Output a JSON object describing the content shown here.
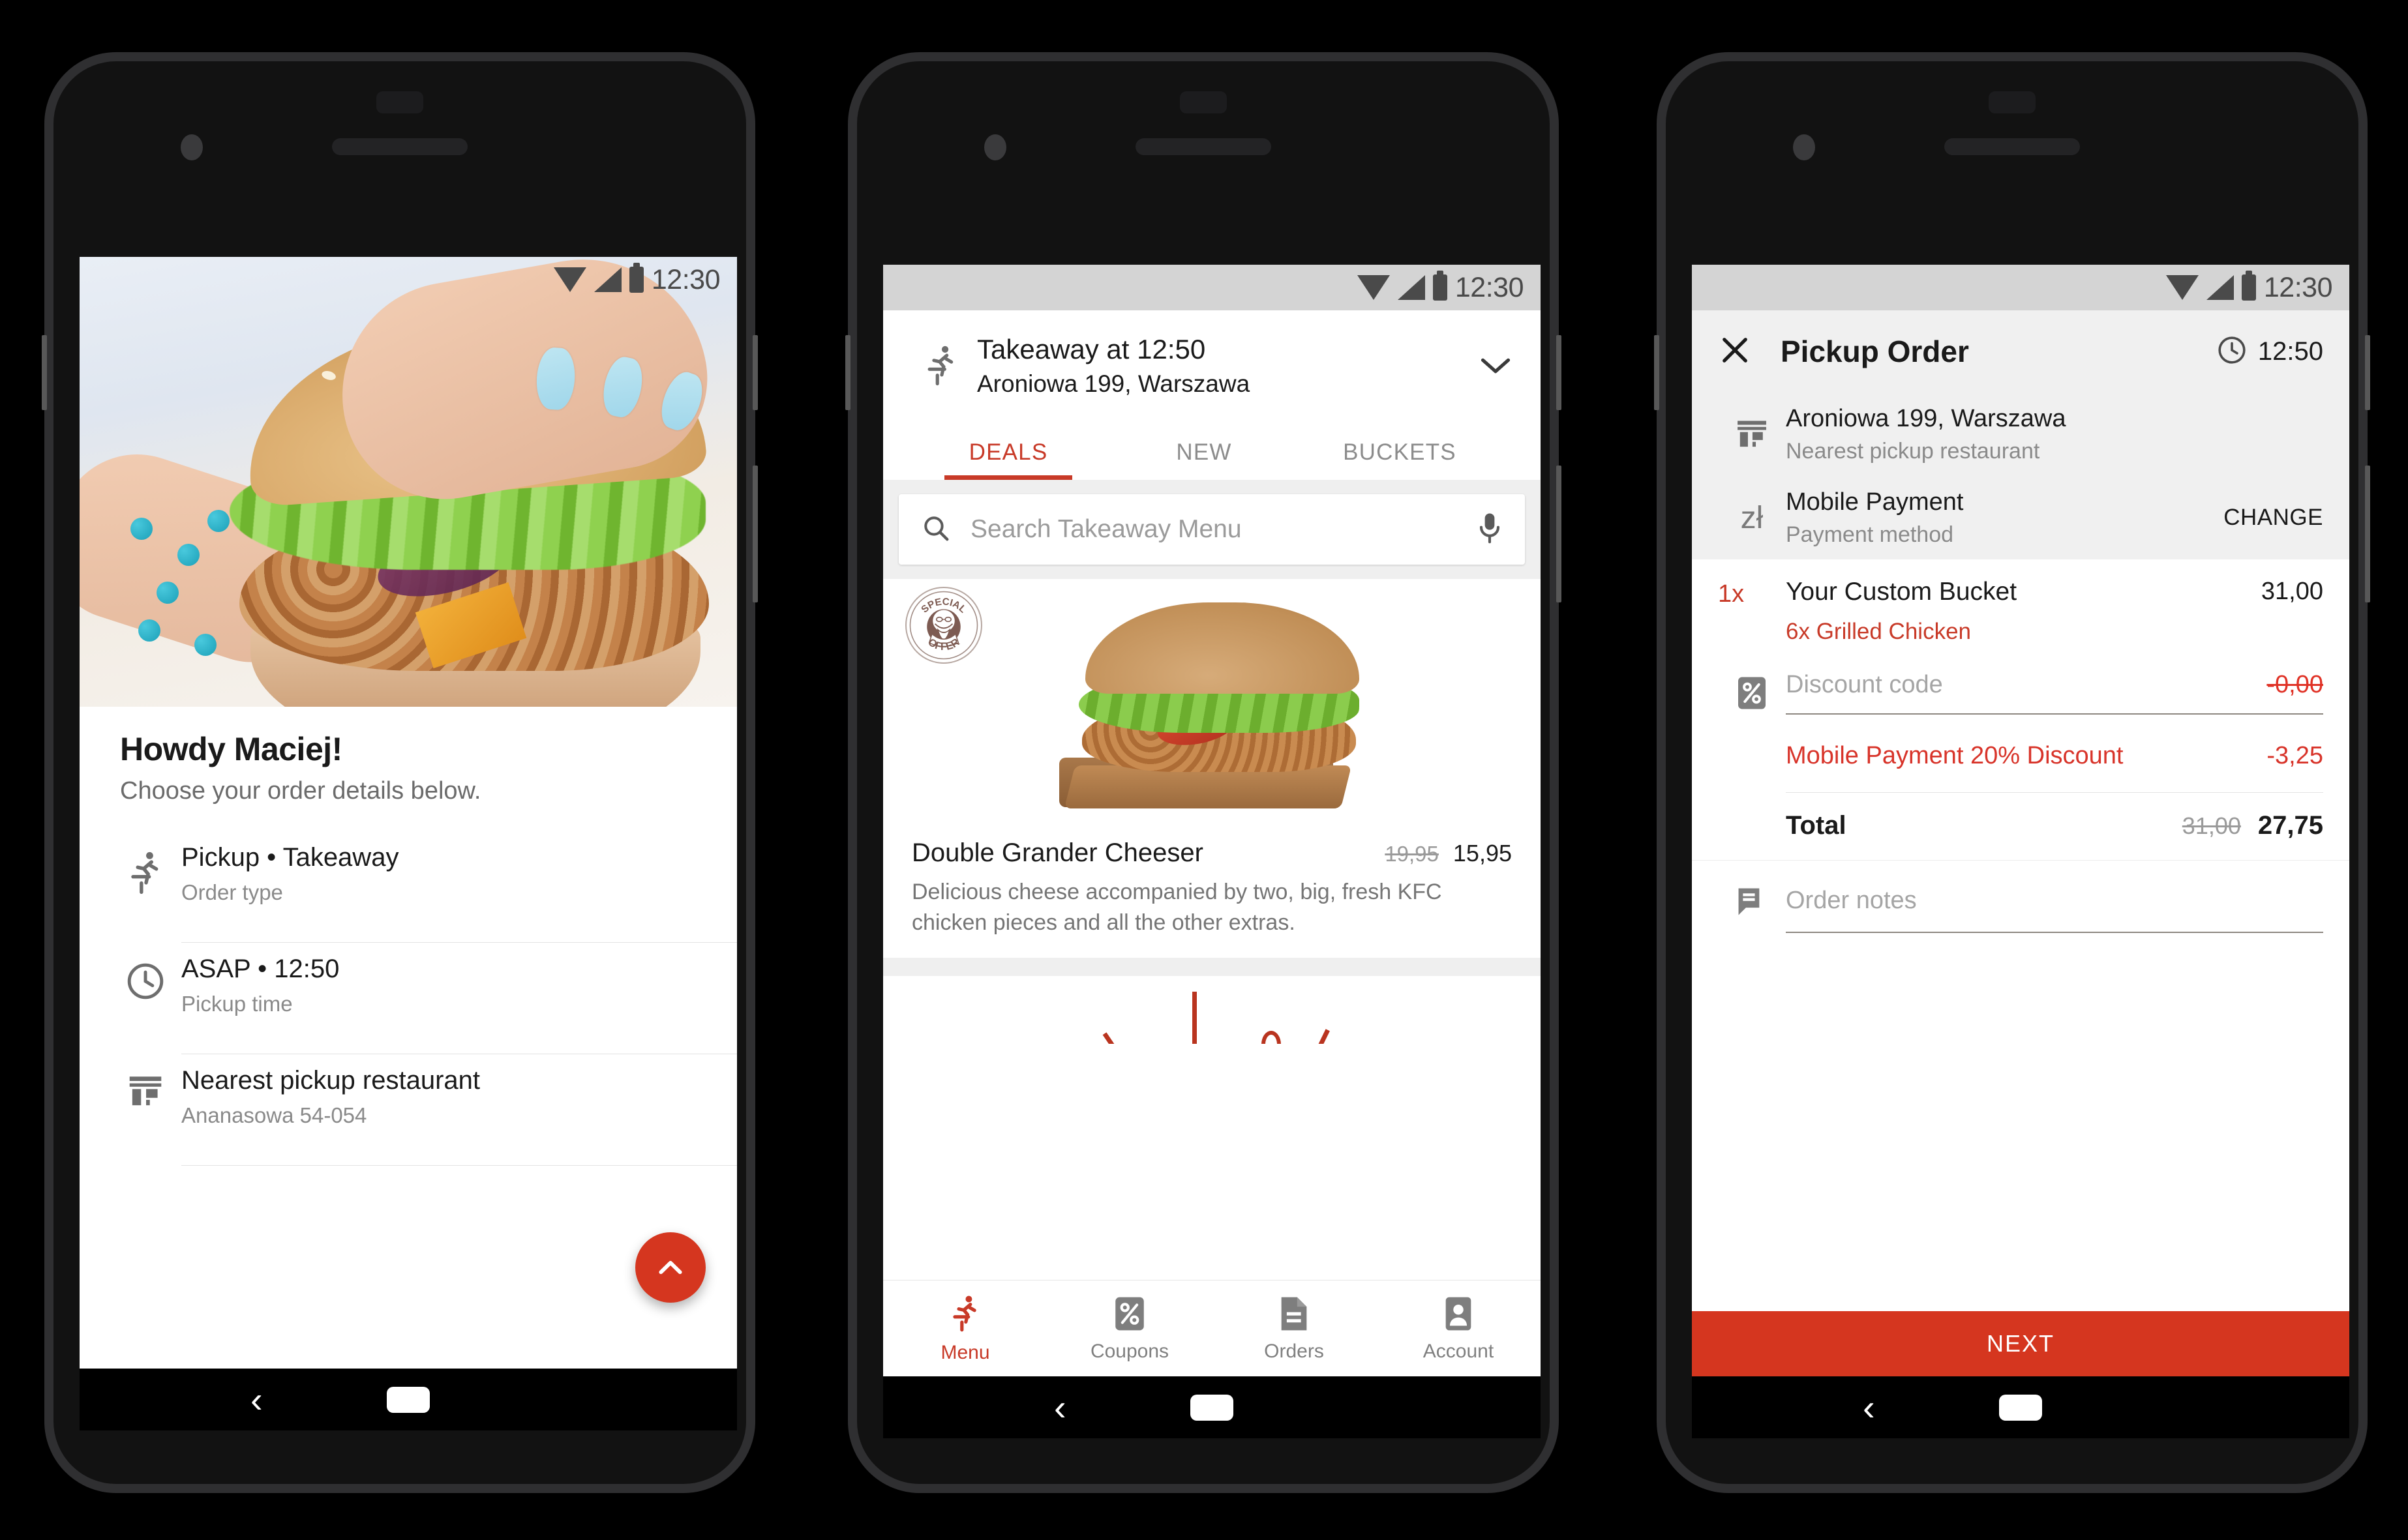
{
  "phones": {
    "phone1": {
      "status_bar": {
        "time": "12:30",
        "icons": [
          "wifi-icon",
          "signal-icon",
          "battery-icon"
        ]
      },
      "greeting": {
        "title": "Howdy Maciej!",
        "subtitle": "Choose your order details below."
      },
      "rows": [
        {
          "icon": "runner-icon",
          "main": "Pickup • Takeaway",
          "sub": "Order type"
        },
        {
          "icon": "clock-icon",
          "main": "ASAP • 12:50",
          "sub": "Pickup time"
        },
        {
          "icon": "store-icon",
          "main": "Nearest pickup restaurant",
          "sub": "Ananasowa 54-054"
        }
      ],
      "fab": {
        "icon": "chevron-up-icon"
      },
      "nav": {
        "back": "‹",
        "home": "home-pill"
      }
    },
    "phone2": {
      "status_bar": {
        "time": "12:30"
      },
      "header": {
        "icon": "runner-icon",
        "line1": "Takeaway at 12:50",
        "line2": "Aroniowa 199, Warszawa",
        "chevron": "chevron-down-icon"
      },
      "tabs": [
        {
          "label": "DEALS",
          "active": true
        },
        {
          "label": "NEW",
          "active": false
        },
        {
          "label": "BUCKETS",
          "active": false
        }
      ],
      "search": {
        "icon": "search-icon",
        "placeholder": "Search Takeaway Menu",
        "mic": "mic-icon"
      },
      "badge": {
        "line1": "SPECIAL",
        "line2": "OFFER",
        "face": "colonel-sanders-icon"
      },
      "product": {
        "name": "Double Grander Cheeser",
        "price_old": "19,95",
        "price_new": "15,95",
        "description": "Delicious cheese accompanied by two, big, fresh KFC chicken pieces and all the other extras."
      },
      "bottom_nav": [
        {
          "label": "Menu",
          "icon": "runner-icon",
          "active": true
        },
        {
          "label": "Coupons",
          "icon": "percent-icon",
          "active": false
        },
        {
          "label": "Orders",
          "icon": "document-icon",
          "active": false
        },
        {
          "label": "Account",
          "icon": "person-card-icon",
          "active": false
        }
      ],
      "nav": {
        "back": "‹"
      }
    },
    "phone3": {
      "status_bar": {
        "time": "12:30"
      },
      "appbar": {
        "close": "close-icon",
        "title": "Pickup Order",
        "clock_icon": "clock-icon",
        "time": "12:50"
      },
      "details": [
        {
          "icon": "store-icon",
          "main": "Aroniowa 199, Warszawa",
          "sub": "Nearest pickup restaurant",
          "action": ""
        },
        {
          "icon": "zloty-icon",
          "main": "Mobile Payment",
          "sub": "Payment method",
          "action": "CHANGE"
        }
      ],
      "item": {
        "qty": "1x",
        "name": "Your Custom Bucket",
        "price": "31,00",
        "option": "6x Grilled Chicken"
      },
      "discount": {
        "icon": "percent-icon",
        "placeholder": "Discount code",
        "value": "-0,00"
      },
      "promo": {
        "label": "Mobile Payment 20% Discount",
        "value": "-3,25"
      },
      "total": {
        "label": "Total",
        "old": "31,00",
        "new": "27,75"
      },
      "notes": {
        "icon": "comment-icon",
        "placeholder": "Order notes"
      },
      "cta": {
        "label": "NEXT"
      },
      "nav": {
        "back": "‹"
      }
    }
  },
  "colors": {
    "brand_red": "#D5361F",
    "tab_red": "#C83A28",
    "discount_red": "#D8342A",
    "status_bar_grey": "#D4D4D4",
    "page_grey": "#F0F0F0"
  }
}
